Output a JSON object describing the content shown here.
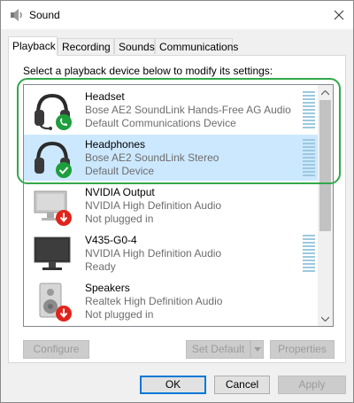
{
  "window": {
    "title": "Sound"
  },
  "tabs": [
    {
      "label": "Playback",
      "active": true
    },
    {
      "label": "Recording",
      "active": false
    },
    {
      "label": "Sounds",
      "active": false
    },
    {
      "label": "Communications",
      "active": false
    }
  ],
  "instruction": "Select a playback device below to modify its settings:",
  "devices": [
    {
      "name": "Headset",
      "line1": "Bose AE2 SoundLink Hands-Free AG Audio",
      "line2": "Default Communications Device",
      "icon": "headset-icon",
      "badge": "phone-badge-icon",
      "selected": false
    },
    {
      "name": "Headphones",
      "line1": "Bose AE2 SoundLink Stereo",
      "line2": "Default Device",
      "icon": "headphones-icon",
      "badge": "check-badge-icon",
      "selected": true
    },
    {
      "name": "NVIDIA Output",
      "line1": "NVIDIA High Definition Audio",
      "line2": "Not plugged in",
      "icon": "monitor-icon",
      "badge": "unplugged-badge-icon",
      "selected": false
    },
    {
      "name": "V435-G0-4",
      "line1": "NVIDIA High Definition Audio",
      "line2": "Ready",
      "icon": "monitor-icon",
      "badge": "",
      "selected": false
    },
    {
      "name": "Speakers",
      "line1": "Realtek High Definition Audio",
      "line2": "Not plugged in",
      "icon": "speaker-icon",
      "badge": "unplugged-badge-icon",
      "selected": false
    }
  ],
  "buttons": {
    "configure": "Configure",
    "set_default": "Set Default",
    "properties": "Properties",
    "ok": "OK",
    "cancel": "Cancel",
    "apply": "Apply"
  },
  "colors": {
    "accent": "#0078d7",
    "selection": "#cce8ff",
    "highlight_ring": "#31a84a",
    "status_green": "#1e9e3c",
    "status_red": "#e0241b"
  }
}
